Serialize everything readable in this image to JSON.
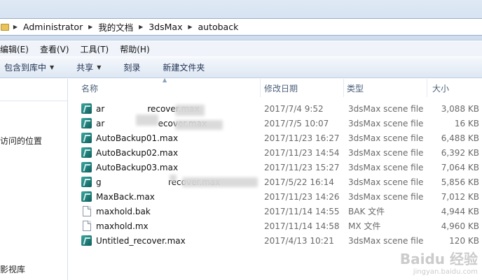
{
  "breadcrumb": [
    "Administrator",
    "我的文档",
    "3dsMax",
    "autoback"
  ],
  "menu": [
    "编辑(E)",
    "查看(V)",
    "工具(T)",
    "帮助(H)"
  ],
  "toolbar": {
    "include_in_library": "包含到库中",
    "share": "共享",
    "burn": "刻录",
    "new_folder": "新建文件夹"
  },
  "nav": {
    "recent_places": "访问的位置",
    "video_library": "影视库"
  },
  "columns": {
    "name": "名称",
    "modified": "修改日期",
    "type": "类型",
    "size": "大小"
  },
  "files": [
    {
      "name": "ar                recover.max",
      "date": "2017/7/4 9:52",
      "type": "3dsMax scene file",
      "size": "3,088 KB",
      "icon": "max-file-icon"
    },
    {
      "name": "ar                    ecover.max",
      "date": "2017/7/5 10:07",
      "type": "3dsMax scene file",
      "size": "16 KB",
      "icon": "max-file-icon"
    },
    {
      "name": "AutoBackup01.max",
      "date": "2017/11/23 16:27",
      "type": "3dsMax scene file",
      "size": "6,488 KB",
      "icon": "max-file-icon"
    },
    {
      "name": "AutoBackup02.max",
      "date": "2017/11/23 14:54",
      "type": "3dsMax scene file",
      "size": "6,392 KB",
      "icon": "max-file-icon"
    },
    {
      "name": "AutoBackup03.max",
      "date": "2017/11/23 15:27",
      "type": "3dsMax scene file",
      "size": "7,064 KB",
      "icon": "max-file-icon"
    },
    {
      "name": "g                         recover.max",
      "date": "2017/5/22 16:14",
      "type": "3dsMax scene file",
      "size": "5,856 KB",
      "icon": "max-file-icon"
    },
    {
      "name": "MaxBack.max",
      "date": "2017/11/23 14:26",
      "type": "3dsMax scene file",
      "size": "7,012 KB",
      "icon": "max-file-icon"
    },
    {
      "name": "maxhold.bak",
      "date": "2017/11/14 14:55",
      "type": "BAK 文件",
      "size": "4,944 KB",
      "icon": "generic-file-icon"
    },
    {
      "name": "maxhold.mx",
      "date": "2017/11/14 14:58",
      "type": "MX 文件",
      "size": "4,960 KB",
      "icon": "generic-file-icon"
    },
    {
      "name": "Untitled_recover.max",
      "date": "2017/4/13 10:21",
      "type": "3dsMax scene file",
      "size": "120 KB",
      "icon": "max-file-icon"
    }
  ],
  "watermark": {
    "main": "Baidu 经验",
    "sub": "jingyan.baidu.com"
  }
}
